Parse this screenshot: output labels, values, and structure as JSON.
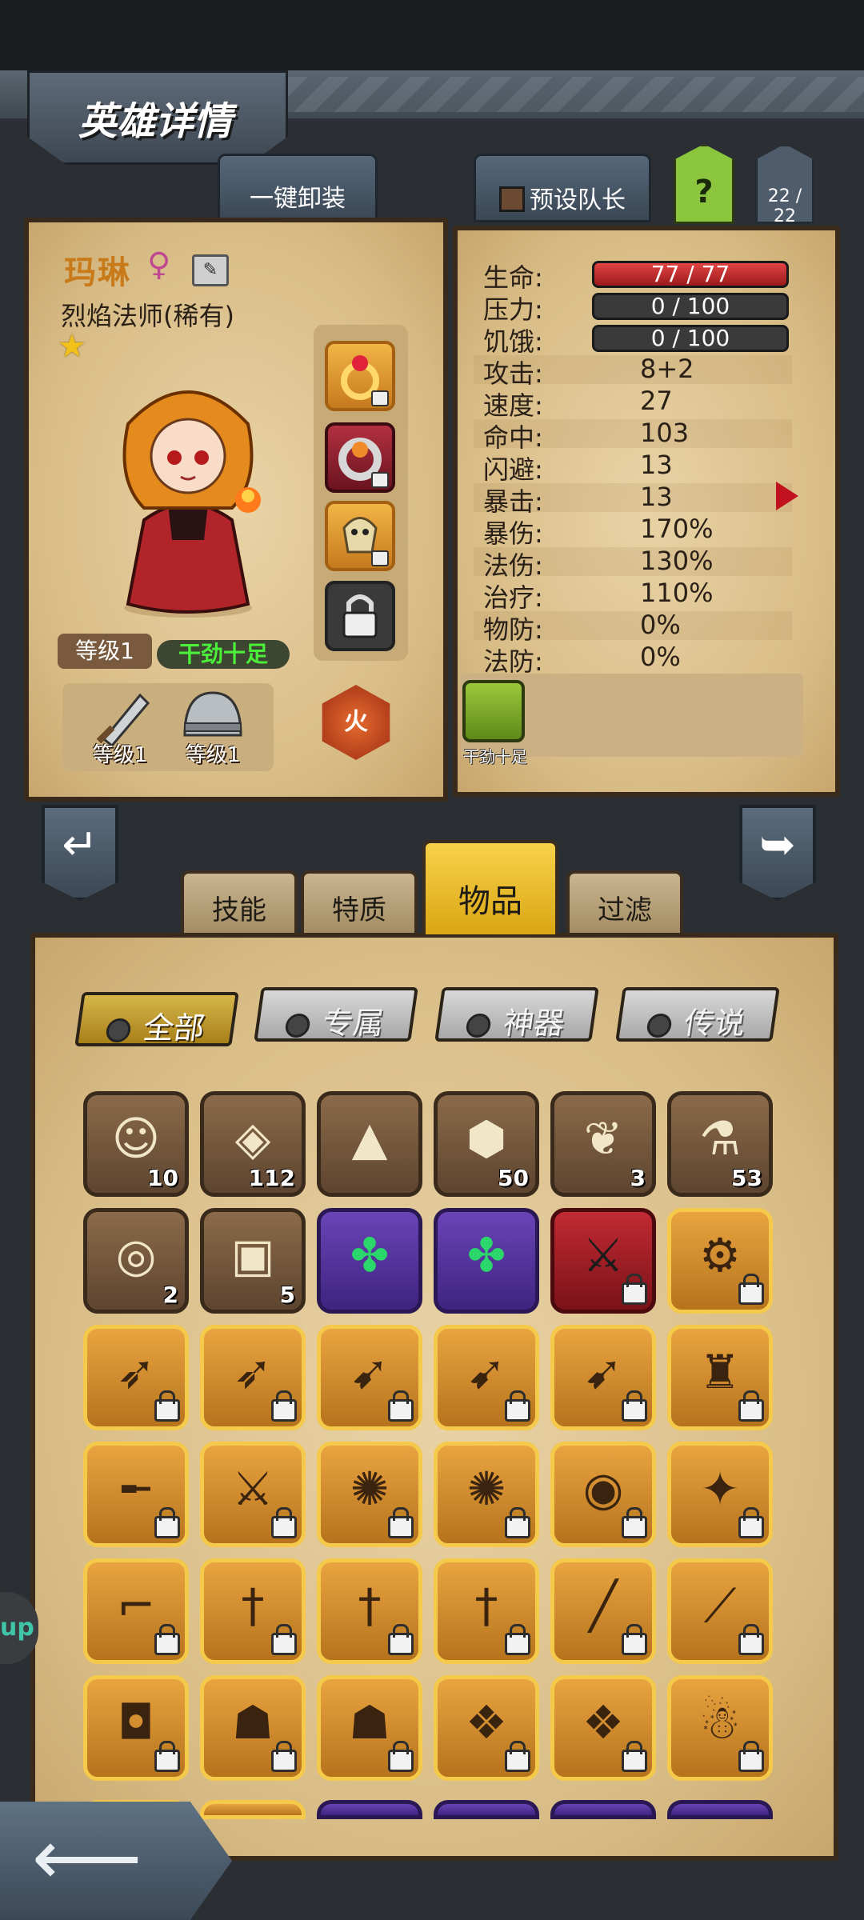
{
  "header": {
    "title": "英雄详情",
    "unequip_all": "一键卸装",
    "preset_leader": "预设队长",
    "help": "?",
    "roster_count": "22 / 22"
  },
  "hero": {
    "name": "玛琳",
    "gender_symbol": "♀",
    "class": "烈焰法师(稀有)",
    "rarity_star": "★",
    "level": "等级1",
    "mood": "干劲十足",
    "weapon_level": "等级1",
    "armor_level": "等级1",
    "element": "火",
    "quirk_label": "干劲十足"
  },
  "stats": {
    "hp": {
      "label": "生命:",
      "value": "77 / 77",
      "fraction": 1.0
    },
    "stress": {
      "label": "压力:",
      "value": "0 / 100",
      "fraction": 0.0
    },
    "hunger": {
      "label": "饥饿:",
      "value": "0 / 100",
      "fraction": 0.0
    },
    "rows": [
      {
        "label": "攻击:",
        "value": "8+2"
      },
      {
        "label": "速度:",
        "value": "27"
      },
      {
        "label": "命中:",
        "value": "103"
      },
      {
        "label": "闪避:",
        "value": "13"
      },
      {
        "label": "暴击:",
        "value": "13"
      },
      {
        "label": "暴伤:",
        "value": "170%"
      },
      {
        "label": "法伤:",
        "value": "130%"
      },
      {
        "label": "治疗:",
        "value": "110%"
      },
      {
        "label": "物防:",
        "value": "0%"
      },
      {
        "label": "法防:",
        "value": "0%"
      }
    ]
  },
  "tabs": {
    "skills": "技能",
    "traits": "特质",
    "items": "物品",
    "filter": "过滤"
  },
  "filters": {
    "all": "全部",
    "exclusive": "专属",
    "artifact": "神器",
    "legend": "传说"
  },
  "side_tag": "up",
  "items": [
    {
      "icon": "hero-portrait-icon",
      "glyph": "☺",
      "frame": "brown",
      "qty": "10",
      "locked": false
    },
    {
      "icon": "orange-gem-icon",
      "glyph": "◈",
      "frame": "brown",
      "qty": "112",
      "locked": false
    },
    {
      "icon": "crystal-sand-pile-icon",
      "glyph": "▲",
      "frame": "brown",
      "qty": "",
      "locked": false
    },
    {
      "icon": "cyan-rune-stone-icon",
      "glyph": "⬢",
      "frame": "brown",
      "qty": "50",
      "locked": false
    },
    {
      "icon": "golden-feather-icon",
      "glyph": "❦",
      "frame": "brown",
      "qty": "3",
      "locked": false
    },
    {
      "icon": "blue-potion-icon",
      "glyph": "⚗",
      "frame": "brown",
      "qty": "53",
      "locked": false
    },
    {
      "icon": "scroll-orb-icon",
      "glyph": "◎",
      "frame": "brown",
      "qty": "2",
      "locked": false
    },
    {
      "icon": "treasure-chest-icon",
      "glyph": "▣",
      "frame": "brown",
      "qty": "5",
      "locked": false
    },
    {
      "icon": "green-gem-icon",
      "glyph": "✤",
      "frame": "purple",
      "qty": "",
      "locked": false
    },
    {
      "icon": "green-gem-icon",
      "glyph": "✤",
      "frame": "purple",
      "qty": "",
      "locked": false
    },
    {
      "icon": "double-axe-icon",
      "glyph": "⚔",
      "frame": "red",
      "qty": "",
      "locked": true
    },
    {
      "icon": "dark-claw-armor-icon",
      "glyph": "⚙",
      "frame": "gold",
      "qty": "",
      "locked": true
    },
    {
      "icon": "crossbow-icon",
      "glyph": "➶",
      "frame": "gold",
      "qty": "",
      "locked": true
    },
    {
      "icon": "crossbow-icon",
      "glyph": "➶",
      "frame": "gold",
      "qty": "",
      "locked": true
    },
    {
      "icon": "dark-bow-icon",
      "glyph": "➹",
      "frame": "gold",
      "qty": "",
      "locked": true
    },
    {
      "icon": "dark-bow-icon",
      "glyph": "➹",
      "frame": "gold",
      "qty": "",
      "locked": true
    },
    {
      "icon": "dark-bow-icon",
      "glyph": "➹",
      "frame": "gold",
      "qty": "",
      "locked": true
    },
    {
      "icon": "red-coat-armor-icon",
      "glyph": "♜",
      "frame": "gold",
      "qty": "",
      "locked": true
    },
    {
      "icon": "rifle-icon",
      "glyph": "╾",
      "frame": "gold",
      "qty": "",
      "locked": true
    },
    {
      "icon": "greatsword-icon",
      "glyph": "⚔",
      "frame": "gold",
      "qty": "",
      "locked": true
    },
    {
      "icon": "flame-staff-icon",
      "glyph": "✺",
      "frame": "gold",
      "qty": "",
      "locked": true
    },
    {
      "icon": "flame-staff-icon",
      "glyph": "✺",
      "frame": "gold",
      "qty": "",
      "locked": true
    },
    {
      "icon": "ruby-ring-icon",
      "glyph": "◉",
      "frame": "gold",
      "qty": "",
      "locked": true
    },
    {
      "icon": "spell-book-icon",
      "glyph": "✦",
      "frame": "gold",
      "qty": "",
      "locked": true
    },
    {
      "icon": "revolver-icon",
      "glyph": "⌐",
      "frame": "gold",
      "qty": "",
      "locked": true
    },
    {
      "icon": "rapier-icon",
      "glyph": "†",
      "frame": "gold",
      "qty": "",
      "locked": true
    },
    {
      "icon": "rapier-icon",
      "glyph": "†",
      "frame": "gold",
      "qty": "",
      "locked": true
    },
    {
      "icon": "rapier-icon",
      "glyph": "†",
      "frame": "gold",
      "qty": "",
      "locked": true
    },
    {
      "icon": "black-staff-icon",
      "glyph": "╱",
      "frame": "gold",
      "qty": "",
      "locked": true
    },
    {
      "icon": "purple-dagger-icon",
      "glyph": "⟋",
      "frame": "gold",
      "qty": "",
      "locked": true
    },
    {
      "icon": "leather-bag-icon",
      "glyph": "◘",
      "frame": "gold",
      "qty": "",
      "locked": true
    },
    {
      "icon": "hooded-cloak-icon",
      "glyph": "☗",
      "frame": "gold",
      "qty": "",
      "locked": true
    },
    {
      "icon": "hooded-cloak-icon",
      "glyph": "☗",
      "frame": "gold",
      "qty": "",
      "locked": true
    },
    {
      "icon": "crystal-armor-icon",
      "glyph": "❖",
      "frame": "gold",
      "qty": "",
      "locked": true
    },
    {
      "icon": "crystal-armor-icon",
      "glyph": "❖",
      "frame": "gold",
      "qty": "",
      "locked": true
    },
    {
      "icon": "voodoo-doll-icon",
      "glyph": "☃",
      "frame": "gold",
      "qty": "",
      "locked": true
    }
  ]
}
